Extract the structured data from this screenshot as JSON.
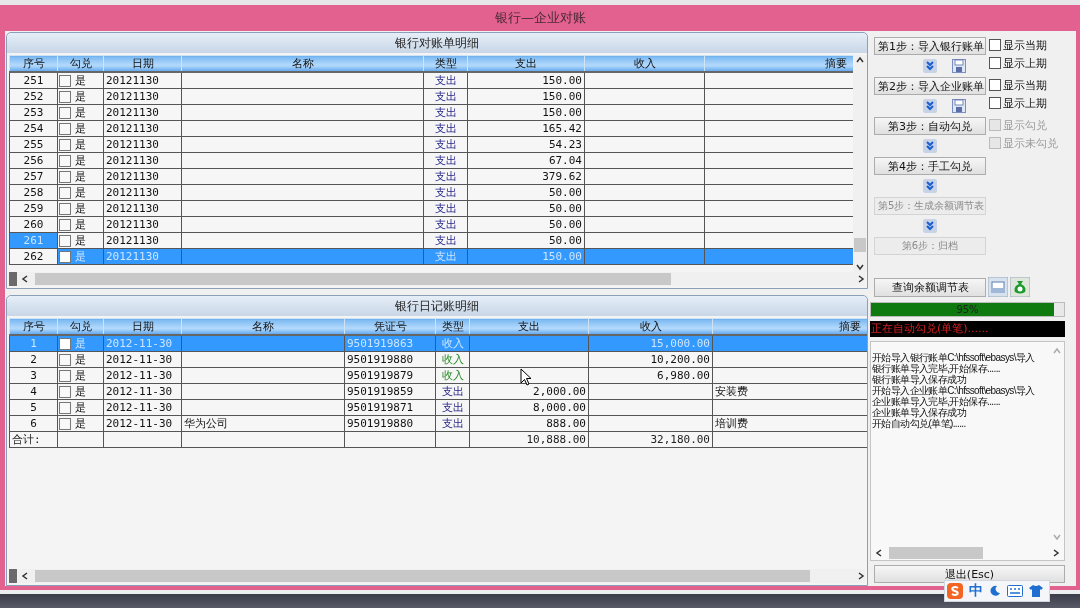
{
  "window": {
    "title": "银行—企业对账"
  },
  "bank_statement": {
    "title": "银行对账单明细",
    "columns": [
      "序号",
      "勾兑",
      "日期",
      "名称",
      "类型",
      "支出",
      "收入",
      "摘要"
    ],
    "rows": [
      {
        "no": "251",
        "checked": false,
        "check_label": "是",
        "date": "20121130",
        "type": "支出",
        "kind": "expense",
        "expense": "150.00",
        "selected": false,
        "focused": false
      },
      {
        "no": "252",
        "checked": false,
        "check_label": "是",
        "date": "20121130",
        "type": "支出",
        "kind": "expense",
        "expense": "150.00",
        "selected": false,
        "focused": false
      },
      {
        "no": "253",
        "checked": false,
        "check_label": "是",
        "date": "20121130",
        "type": "支出",
        "kind": "expense",
        "expense": "150.00",
        "selected": false,
        "focused": false
      },
      {
        "no": "254",
        "checked": false,
        "check_label": "是",
        "date": "20121130",
        "type": "支出",
        "kind": "expense",
        "expense": "165.42",
        "selected": false,
        "focused": false
      },
      {
        "no": "255",
        "checked": false,
        "check_label": "是",
        "date": "20121130",
        "type": "支出",
        "kind": "expense",
        "expense": "54.23",
        "selected": false,
        "focused": false
      },
      {
        "no": "256",
        "checked": false,
        "check_label": "是",
        "date": "20121130",
        "type": "支出",
        "kind": "expense",
        "expense": "67.04",
        "selected": false,
        "focused": false
      },
      {
        "no": "257",
        "checked": false,
        "check_label": "是",
        "date": "20121130",
        "type": "支出",
        "kind": "expense",
        "expense": "379.62",
        "selected": false,
        "focused": false
      },
      {
        "no": "258",
        "checked": false,
        "check_label": "是",
        "date": "20121130",
        "type": "支出",
        "kind": "expense",
        "expense": "50.00",
        "selected": false,
        "focused": false
      },
      {
        "no": "259",
        "checked": false,
        "check_label": "是",
        "date": "20121130",
        "type": "支出",
        "kind": "expense",
        "expense": "50.00",
        "selected": false,
        "focused": false
      },
      {
        "no": "260",
        "checked": false,
        "check_label": "是",
        "date": "20121130",
        "type": "支出",
        "kind": "expense",
        "expense": "50.00",
        "selected": false,
        "focused": false
      },
      {
        "no": "261",
        "checked": false,
        "check_label": "是",
        "date": "20121130",
        "type": "支出",
        "kind": "expense",
        "expense": "50.00",
        "selected": false,
        "focused": true
      },
      {
        "no": "262",
        "checked": false,
        "check_label": "是",
        "date": "20121130",
        "type": "支出",
        "kind": "expense",
        "expense": "150.00",
        "selected": true,
        "focused": false
      }
    ]
  },
  "journal": {
    "title": "银行日记账明细",
    "columns": [
      "序号",
      "勾兑",
      "日期",
      "名称",
      "凭证号",
      "类型",
      "支出",
      "收入",
      "摘要"
    ],
    "rows": [
      {
        "no": "1",
        "checked": false,
        "check_label": "是",
        "date": "2012-11-30",
        "voucher": "9501919863",
        "type": "收入",
        "kind": "income",
        "income": "15,000.00",
        "selected": true,
        "focused": true
      },
      {
        "no": "2",
        "checked": false,
        "check_label": "是",
        "date": "2012-11-30",
        "voucher": "9501919880",
        "type": "收入",
        "kind": "income",
        "income": "10,200.00",
        "selected": false,
        "focused": false
      },
      {
        "no": "3",
        "checked": false,
        "check_label": "是",
        "date": "2012-11-30",
        "voucher": "9501919879",
        "type": "收入",
        "kind": "income",
        "income": "6,980.00",
        "selected": false,
        "focused": false
      },
      {
        "no": "4",
        "checked": false,
        "check_label": "是",
        "date": "2012-11-30",
        "voucher": "9501919859",
        "type": "支出",
        "kind": "expense",
        "expense": "2,000.00",
        "memo": "安装费",
        "selected": false,
        "focused": false
      },
      {
        "no": "5",
        "checked": false,
        "check_label": "是",
        "date": "2012-11-30",
        "voucher": "9501919871",
        "type": "支出",
        "kind": "expense",
        "expense": "8,000.00",
        "selected": false,
        "focused": false
      },
      {
        "no": "6",
        "checked": false,
        "check_label": "是",
        "date": "2012-11-30",
        "name": "华为公司",
        "voucher": "9501919880",
        "type": "支出",
        "kind": "expense",
        "expense": "888.00",
        "memo": "培训费",
        "selected": false,
        "focused": false
      }
    ],
    "totals": {
      "label": "合计:",
      "expense": "10,888.00",
      "income": "32,180.00"
    }
  },
  "steps": [
    {
      "label": "第1步：导入银行账单",
      "disabled": false,
      "arrow_below": true,
      "save_icon": true,
      "options": [
        {
          "label": "显示当期",
          "checked": false,
          "disabled": false
        },
        {
          "label": "显示上期",
          "checked": false,
          "disabled": false
        }
      ]
    },
    {
      "label": "第2步：导入企业账单",
      "disabled": false,
      "arrow_below": true,
      "save_icon": true,
      "options": [
        {
          "label": "显示当期",
          "checked": false,
          "disabled": false
        },
        {
          "label": "显示上期",
          "checked": false,
          "disabled": false
        }
      ]
    },
    {
      "label": "第3步：自动勾兑",
      "disabled": false,
      "arrow_below": true,
      "save_icon": false,
      "options": [
        {
          "label": "显示勾兑",
          "checked": false,
          "disabled": true
        },
        {
          "label": "显示未勾兑",
          "checked": false,
          "disabled": true
        }
      ]
    },
    {
      "label": "第4步：手工勾兑",
      "disabled": false,
      "arrow_below": true,
      "save_icon": false
    },
    {
      "label": "第5步：生成余额调节表",
      "disabled": true,
      "arrow_below": true,
      "save_icon": false
    },
    {
      "label": "第6步：归档",
      "disabled": true,
      "arrow_below": false,
      "save_icon": false
    }
  ],
  "query_button": {
    "label": "查询余额调节表"
  },
  "progress": {
    "level": 0.95,
    "reading": "95%"
  },
  "status_message": "正在自动勾兑(单笔)......",
  "log": [
    "开始导入银行账单C:\\hfssoft\\ebasys\\导入",
    "银行账单导入完毕,开始保存......",
    "银行账单导入保存成功",
    "开始导入企业账单C:\\hfssoft\\ebasys\\导入",
    "企业账单导入完毕,开始保存......",
    "企业账单导入保存成功",
    "开始自动勾兑(单笔)......"
  ],
  "exit_button": {
    "label": "退出(Esc)"
  },
  "ime_toolbar": {
    "mode": "中"
  }
}
